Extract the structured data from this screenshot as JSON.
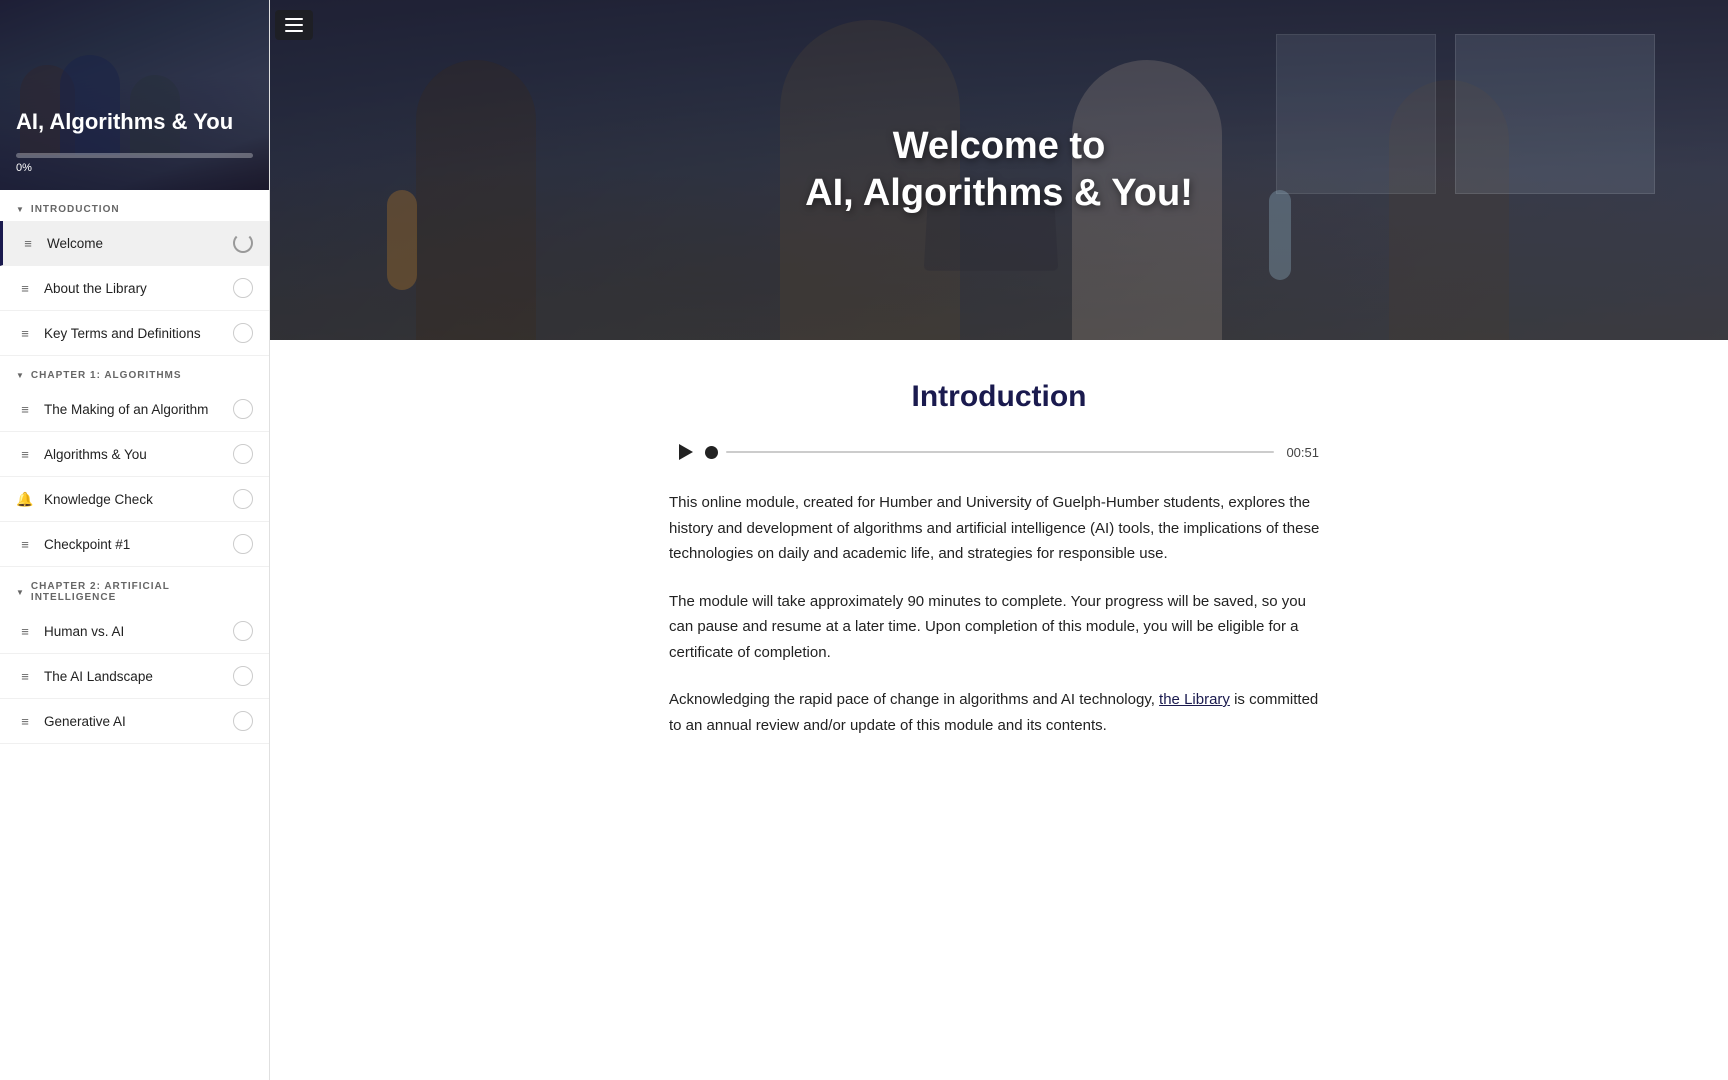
{
  "sidebar": {
    "title": "AI, Algorithms & You",
    "progress": 0,
    "progress_label": "0%",
    "sections": [
      {
        "id": "introduction",
        "label": "INTRODUCTION",
        "items": [
          {
            "id": "welcome",
            "label": "Welcome",
            "icon": "menu",
            "status": "loading",
            "active": true
          },
          {
            "id": "about-library",
            "label": "About the Library",
            "icon": "menu",
            "status": "empty"
          },
          {
            "id": "key-terms",
            "label": "Key Terms and Definitions",
            "icon": "menu",
            "status": "empty"
          }
        ]
      },
      {
        "id": "chapter1",
        "label": "CHAPTER 1: ALGORITHMS",
        "items": [
          {
            "id": "making-algorithm",
            "label": "The Making of an Algorithm",
            "icon": "menu",
            "status": "empty"
          },
          {
            "id": "algorithms-you",
            "label": "Algorithms & You",
            "icon": "menu",
            "status": "empty"
          },
          {
            "id": "knowledge-check",
            "label": "Knowledge Check",
            "icon": "knowledge-check",
            "status": "empty"
          },
          {
            "id": "checkpoint1",
            "label": "Checkpoint #1",
            "icon": "menu",
            "status": "empty"
          }
        ]
      },
      {
        "id": "chapter2",
        "label": "CHAPTER 2: ARTIFICIAL INTELLIGENCE",
        "items": [
          {
            "id": "human-vs-ai",
            "label": "Human vs. AI",
            "icon": "menu",
            "status": "empty"
          },
          {
            "id": "ai-landscape",
            "label": "The AI Landscape",
            "icon": "menu",
            "status": "empty"
          },
          {
            "id": "generative-ai",
            "label": "Generative AI",
            "icon": "menu",
            "status": "empty"
          }
        ]
      }
    ]
  },
  "hero": {
    "line1": "Welcome to",
    "line2": "AI, Algorithms & You!"
  },
  "main": {
    "section_title": "Introduction",
    "audio_time": "00:51",
    "paragraphs": [
      "This online module, created for Humber and University of Guelph-Humber students, explores the history and development of algorithms and artificial intelligence (AI) tools, the implications of these technologies on daily and academic life, and strategies for responsible use.",
      "The module will take approximately 90 minutes to complete. Your progress will be saved, so you can pause and resume at a later time. Upon completion of this module, you will be eligible for a certificate of completion.",
      "Acknowledging the rapid pace of change in algorithms and AI technology, the Library is committed to an annual review and/or update of this module and its contents."
    ],
    "library_link_text": "the Library"
  },
  "menu_button_label": "☰"
}
